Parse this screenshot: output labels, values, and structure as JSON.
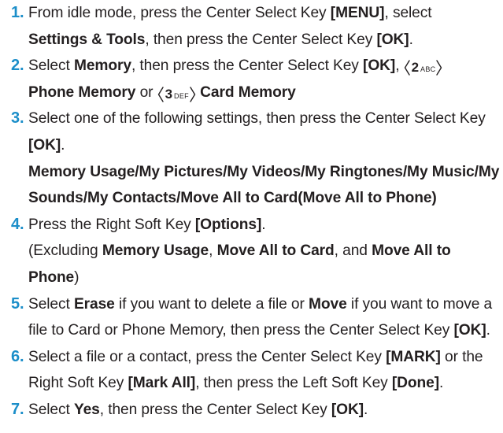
{
  "steps": [
    {
      "number": "1.",
      "parts": {
        "a": "From idle mode, press the Center Select Key ",
        "b": "[MENU]",
        "c": ", select",
        "d": "Settings & Tools",
        "e": ", then press the Center Select Key ",
        "f": "[OK]",
        "g": "."
      }
    },
    {
      "number": "2.",
      "parts": {
        "a": "Select ",
        "b": "Memory",
        "c": ", then press the Center Select Key ",
        "d": "[OK]",
        "e": ", ",
        "key1_num": "2",
        "key1_letters": "ABC",
        "f": "Phone Memory",
        "g": " or ",
        "key2_num": "3",
        "key2_letters": "DEF",
        "h": "Card Memory"
      }
    },
    {
      "number": "3.",
      "parts": {
        "a": "Select one of the following settings, then press the Center Select Key ",
        "b": "[OK]",
        "c": ".",
        "d": "Memory Usage/My Pictures/My Videos/My Ringtones/My Music/My Sounds/My Contacts/Move All to Card(Move All to Phone)"
      }
    },
    {
      "number": "4.",
      "parts": {
        "a": "Press the Right Soft Key ",
        "b": "[Options]",
        "c": ".",
        "d": "(Excluding ",
        "e": "Memory Usage",
        "f": ", ",
        "g": "Move All to Card",
        "h": ", and ",
        "i": "Move All to Phone",
        "j": ")"
      }
    },
    {
      "number": "5.",
      "parts": {
        "a": "Select ",
        "b": "Erase",
        "c": " if you want to delete a file or ",
        "d": "Move",
        "e": " if you want to move a file to Card or Phone Memory, then press the Center Select Key ",
        "f": "[OK]",
        "g": "."
      }
    },
    {
      "number": "6.",
      "parts": {
        "a": "Select a file or a contact, press the Center Select Key ",
        "b": "[MARK]",
        "c": " or the Right Soft Key ",
        "d": "[Mark All]",
        "e": ", then press the Left Soft Key ",
        "f": "[Done]",
        "g": "."
      }
    },
    {
      "number": "7.",
      "parts": {
        "a": "Select ",
        "b": "Yes",
        "c": ", then press the Center Select Key ",
        "d": "[OK]",
        "e": "."
      }
    }
  ],
  "colors": {
    "step_number": "#1b8ec9",
    "text": "#231f20"
  },
  "icons": {
    "key2": "keypad-2-abc-icon",
    "key3": "keypad-3-def-icon"
  }
}
